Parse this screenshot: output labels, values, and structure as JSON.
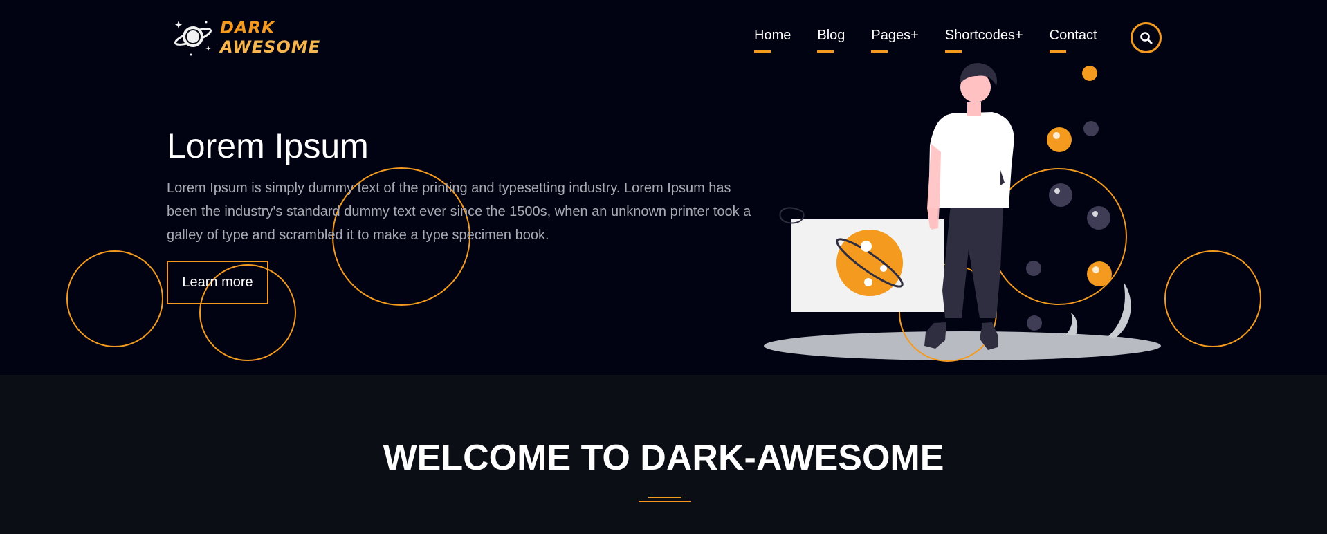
{
  "brand": {
    "line1": "DARK",
    "line2": "AWESOME"
  },
  "nav": {
    "items": [
      {
        "label": "Home"
      },
      {
        "label": "Blog"
      },
      {
        "label": "Pages+"
      },
      {
        "label": "Shortcodes+"
      },
      {
        "label": "Contact"
      }
    ],
    "search_icon": "search-icon"
  },
  "hero": {
    "title": "Lorem Ipsum",
    "description": "Lorem Ipsum is simply dummy text of the printing and typesetting industry. Lorem Ipsum has been the industry's standard dummy text ever since the 1500s, when an unknown printer took a galley of type and scrambled it to make a type specimen book.",
    "button_label": "Learn more"
  },
  "welcome": {
    "title": "WELCOME TO DARK-AWESOME"
  },
  "colors": {
    "accent": "#f39a1f",
    "hero_bg": "#020312",
    "section_bg": "#0c0e15",
    "text_muted": "#a9abb3"
  }
}
